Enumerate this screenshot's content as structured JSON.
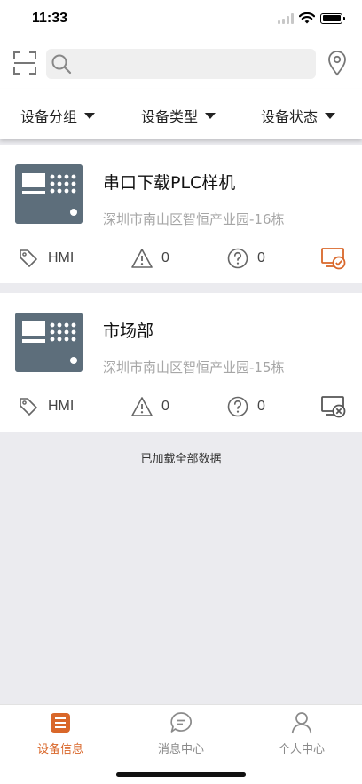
{
  "status_bar": {
    "time": "11:33"
  },
  "search": {
    "placeholder": "",
    "value": ""
  },
  "filters": [
    {
      "label": "设备分组"
    },
    {
      "label": "设备类型"
    },
    {
      "label": "设备状态"
    }
  ],
  "devices": [
    {
      "name": "串口下载PLC样机",
      "address": "深圳市南山区智恒产业园-16栋",
      "type": "HMI",
      "alarms": "0",
      "unknown": "0",
      "status_icon": "monitor-online-icon"
    },
    {
      "name": "市场部",
      "address": "深圳市南山区智恒产业园-15栋",
      "type": "HMI",
      "alarms": "0",
      "unknown": "0",
      "status_icon": "monitor-offline-icon"
    }
  ],
  "list_footer": "已加载全部数据",
  "tabbar": {
    "tabs": [
      {
        "label": "设备信息",
        "icon": "list-icon",
        "active": true
      },
      {
        "label": "消息中心",
        "icon": "chat-bubble-icon",
        "active": false
      },
      {
        "label": "个人中心",
        "icon": "user-icon",
        "active": false
      }
    ]
  },
  "colors": {
    "accent": "#d9672a",
    "background": "#ebebef",
    "device_thumb": "#5d6e7b"
  }
}
